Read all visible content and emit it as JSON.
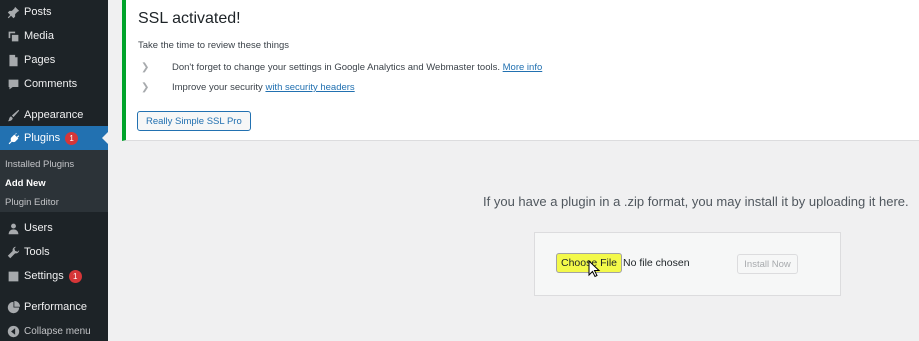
{
  "sidebar": {
    "items": [
      {
        "label": "Posts",
        "icon": "pin-icon"
      },
      {
        "label": "Media",
        "icon": "media-icon"
      },
      {
        "label": "Pages",
        "icon": "pages-icon"
      },
      {
        "label": "Comments",
        "icon": "comments-icon"
      },
      {
        "label": "Appearance",
        "icon": "brush-icon"
      },
      {
        "label": "Plugins",
        "icon": "plug-icon",
        "badge": "1"
      },
      {
        "label": "Users",
        "icon": "users-icon"
      },
      {
        "label": "Tools",
        "icon": "wrench-icon"
      },
      {
        "label": "Settings",
        "icon": "settings-icon",
        "badge": "1"
      },
      {
        "label": "Performance",
        "icon": "performance-icon"
      },
      {
        "label": "Collapse menu",
        "icon": "collapse-icon"
      }
    ],
    "submenu": [
      "Installed Plugins",
      "Add New",
      "Plugin Editor"
    ]
  },
  "notice": {
    "title": "SSL activated!",
    "intro": "Take the time to review these things",
    "tip1_text": "Don't forget to change your settings in Google Analytics and Webmaster tools.",
    "tip1_link": "More info",
    "tip2_text": "Improve your security",
    "tip2_link": "with security headers",
    "button": "Really Simple SSL Pro"
  },
  "upload": {
    "help": "If you have a plugin in a .zip format, you may install it by uploading it here.",
    "choose_file": "Choose File",
    "no_file": "No file chosen",
    "install": "Install Now"
  },
  "colors": {
    "sidebar_bg": "#1d2327",
    "active": "#2271b1",
    "success_border": "#00a32a",
    "highlight": "#f3f94a",
    "badge": "#d63638"
  }
}
